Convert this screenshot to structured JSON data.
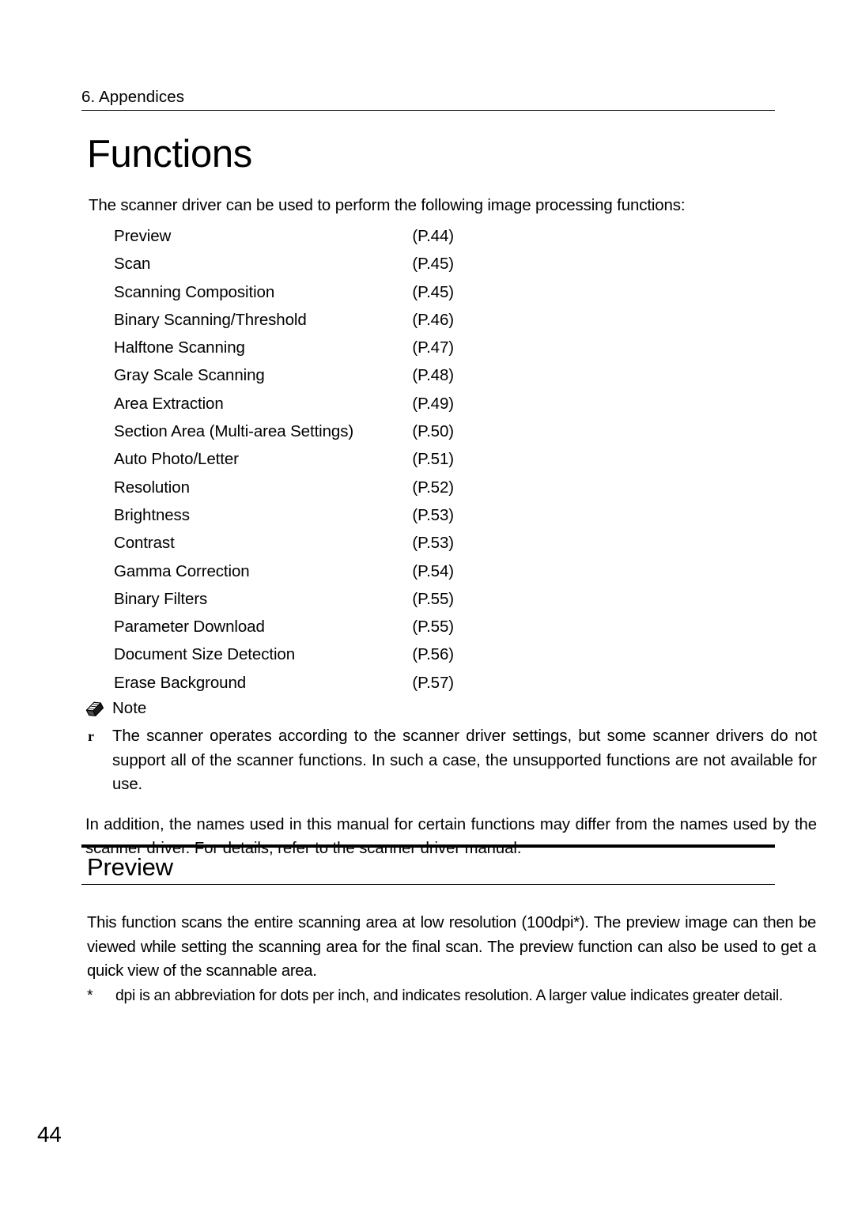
{
  "header": {
    "chapter": "6. Appendices"
  },
  "title": "Functions",
  "intro": "The scanner driver can be used to perform the following image processing functions:",
  "function_list": [
    {
      "name": "Preview",
      "page_ref": "(P.44)"
    },
    {
      "name": "Scan",
      "page_ref": "(P.45)"
    },
    {
      "name": "Scanning Composition",
      "page_ref": "(P.45)"
    },
    {
      "name": "Binary Scanning/Threshold",
      "page_ref": "(P.46)"
    },
    {
      "name": "Halftone Scanning",
      "page_ref": "(P.47)"
    },
    {
      "name": "Gray Scale Scanning",
      "page_ref": "(P.48)"
    },
    {
      "name": "Area Extraction",
      "page_ref": "(P.49)"
    },
    {
      "name": "Section Area (Multi-area Settings)",
      "page_ref": "(P.50)"
    },
    {
      "name": "Auto Photo/Letter",
      "page_ref": "(P.51)"
    },
    {
      "name": "Resolution",
      "page_ref": "(P.52)"
    },
    {
      "name": "Brightness",
      "page_ref": "(P.53)"
    },
    {
      "name": "Contrast",
      "page_ref": "(P.53)"
    },
    {
      "name": "Gamma Correction",
      "page_ref": "(P.54)"
    },
    {
      "name": "Binary Filters",
      "page_ref": "(P.55)"
    },
    {
      "name": "Parameter Download",
      "page_ref": "(P.55)"
    },
    {
      "name": "Document Size Detection",
      "page_ref": "(P.56)"
    },
    {
      "name": "Erase Background",
      "page_ref": "(P.57)"
    }
  ],
  "note": {
    "icon": "pencil-eraser-icon",
    "label": "Note",
    "bullet": "r",
    "paragraph_1": "The scanner operates according to the scanner driver settings, but some scanner drivers do not support all of the scanner functions.  In such a case, the unsupported functions are not available for use.",
    "paragraph_2": "In addition, the names used in this manual for certain functions may differ from the names used by the scanner driver.  For details, refer to the scanner driver manual."
  },
  "section": {
    "heading": "Preview",
    "body": "This function scans the entire scanning area at low resolution (100dpi*).  The preview image can then be viewed while setting the scanning area for the final scan.  The preview function can also be used to get a quick view of the scannable area.",
    "footnote_marker": "*",
    "footnote": "dpi  is an abbreviation for  dots per inch,  and indicates resolution. A larger value indicates greater detail."
  },
  "folio": "44"
}
